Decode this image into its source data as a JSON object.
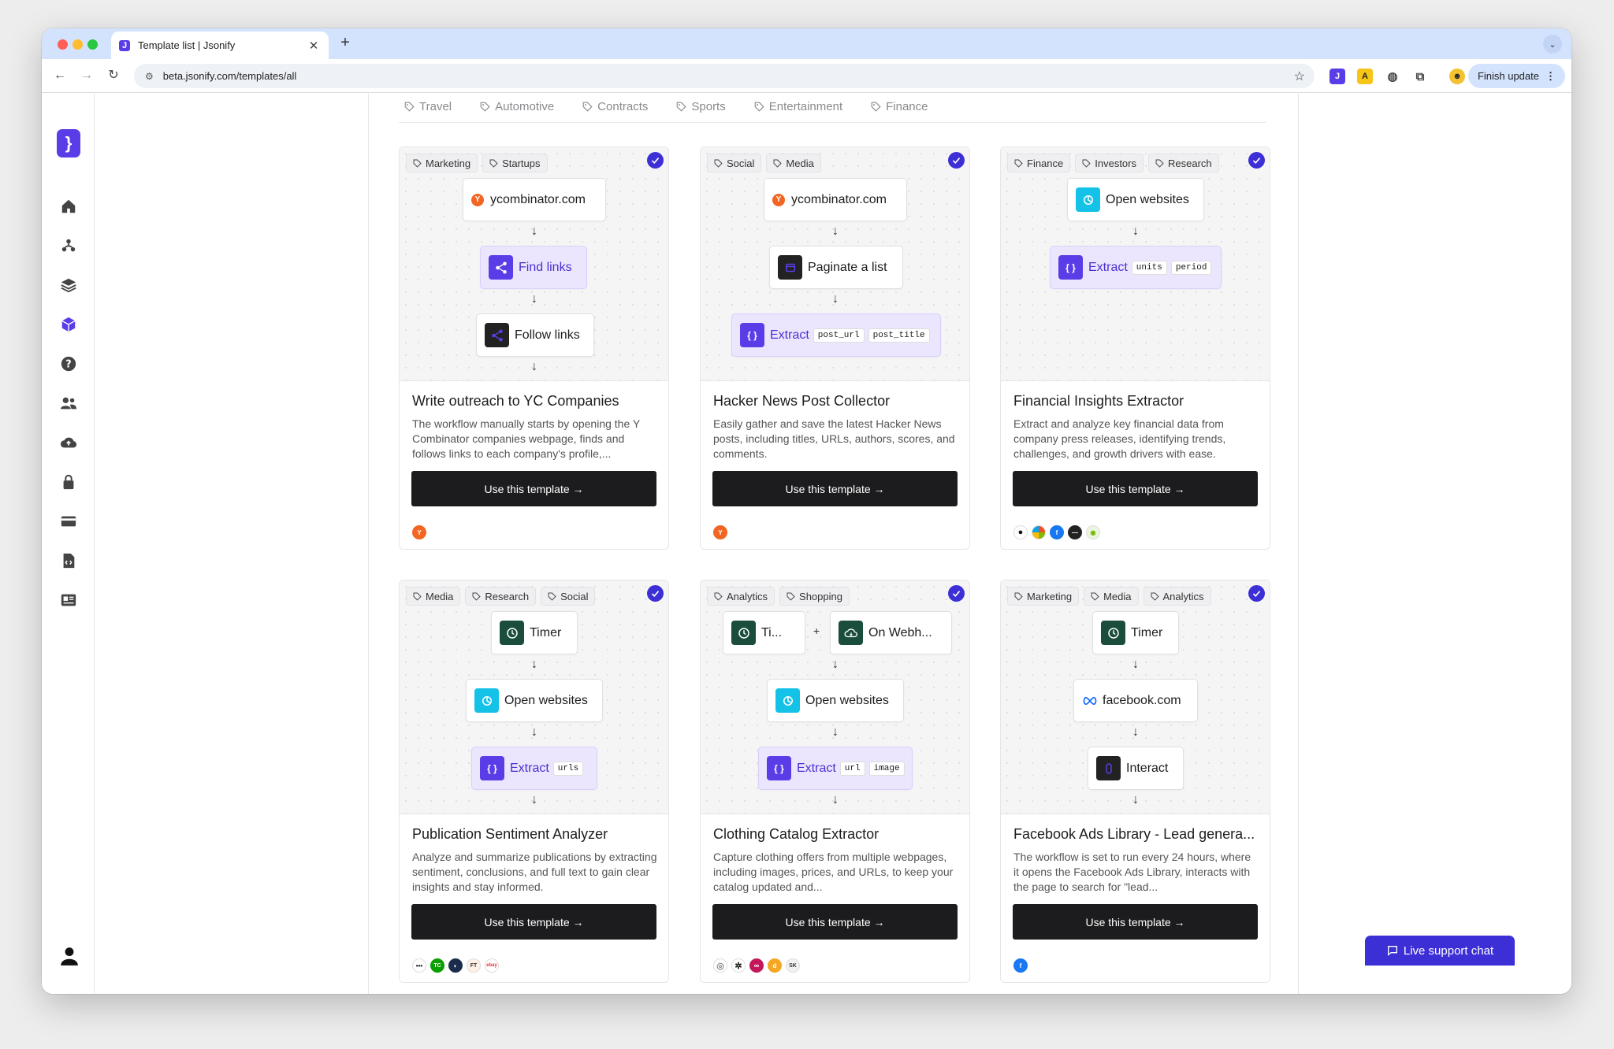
{
  "browser": {
    "tab_title": "Template list | Jsonify",
    "tab_favicon": "J",
    "new_tab_label": "+",
    "close_tab_label": "✕",
    "url": "beta.jsonify.com/templates/all",
    "finish_update_label": "Finish update",
    "tab_menu_glyph": "⌄",
    "kebab": "⋮"
  },
  "app": {
    "logo_glyph": "}"
  },
  "categories": [
    "Travel",
    "Automotive",
    "Contracts",
    "Sports",
    "Entertainment",
    "Finance"
  ],
  "cards": [
    {
      "tags": [
        "Marketing",
        "Startups"
      ],
      "n1": "ycombinator.com",
      "n2": "Find links",
      "n3": "Follow links",
      "title": "Write outreach to YC Companies",
      "description": "The workflow manually starts by opening the Y Combinator companies webpage, finds and follows links to each company's profile,...",
      "button": "Use this template →"
    },
    {
      "tags": [
        "Social",
        "Media"
      ],
      "n1": "ycombinator.com",
      "n2": "Paginate a list",
      "n3_label": "Extract",
      "n3_fields": [
        "post_url",
        "post_title"
      ],
      "title": "Hacker News Post Collector",
      "description": "Easily gather and save the latest Hacker News posts, including titles, URLs, authors, scores, and comments.",
      "button": "Use this template →"
    },
    {
      "tags": [
        "Finance",
        "Investors",
        "Research"
      ],
      "n1": "Open websites",
      "n2_label": "Extract",
      "n2_fields": [
        "units",
        "period"
      ],
      "title": "Financial Insights Extractor",
      "description": "Extract and analyze key financial data from company press releases, identifying trends, challenges, and growth drivers with ease.",
      "button": "Use this template →"
    },
    {
      "tags": [
        "Media",
        "Research",
        "Social"
      ],
      "n1": "Timer",
      "n2": "Open websites",
      "n3_label": "Extract",
      "n3_fields": [
        "urls"
      ],
      "title": "Publication Sentiment Analyzer",
      "description": "Analyze and summarize publications by extracting sentiment, conclusions, and full text to gain clear insights and stay informed.",
      "button": "Use this template →"
    },
    {
      "tags": [
        "Analytics",
        "Shopping"
      ],
      "n1a": "Ti...",
      "n1b": "On Webh...",
      "plus": "+",
      "n2": "Open websites",
      "n3_label": "Extract",
      "n3_fields": [
        "url",
        "image"
      ],
      "title": "Clothing Catalog Extractor",
      "description": "Capture clothing offers from multiple webpages, including images, prices, and URLs, to keep your catalog updated and...",
      "button": "Use this template →"
    },
    {
      "tags": [
        "Marketing",
        "Media",
        "Analytics"
      ],
      "n1": "Timer",
      "n2": "facebook.com",
      "n3": "Interact",
      "title": "Facebook Ads Library - Lead genera...",
      "description": "The workflow is set to run every 24 hours, where it opens the Facebook Ads Library, interacts with the page to search for \"lead...",
      "button": "Use this template →"
    }
  ],
  "logo_text": {
    "yc": "Y",
    "tc": "TC",
    "ft": "FT",
    "sk": "SK"
  },
  "support_chat_label": "Live support chat",
  "colors": {
    "brand": "#5b3de8",
    "check": "#3d2fd6",
    "button": "#1c1c1e",
    "tabbar": "#d3e3fd"
  }
}
